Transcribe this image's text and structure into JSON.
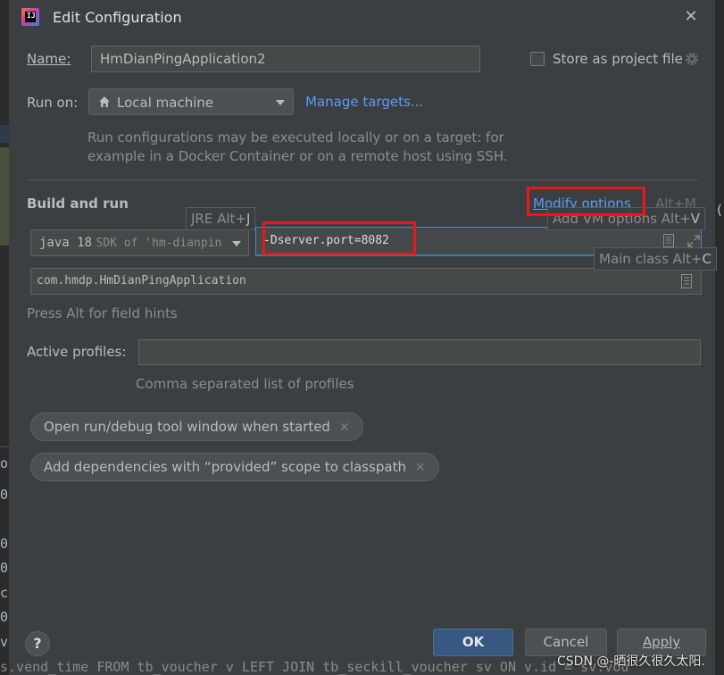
{
  "dialog": {
    "title": "Edit Configuration",
    "app_icon_text": "IJ"
  },
  "name": {
    "label": "Name:",
    "value": "HmDianPingApplication2"
  },
  "store": {
    "label": "Store as project file",
    "checked": false
  },
  "run_on": {
    "label": "Run on:",
    "value": "Local machine",
    "manage_targets": "Manage targets...",
    "hint_line1": "Run configurations may be executed locally or on a target: for",
    "hint_line2": "example in a Docker Container or on a remote host using SSH."
  },
  "build_run": {
    "heading": "Build and run",
    "modify_options": "Modify options",
    "modify_shortcut": "Alt+M",
    "jre_value": "java 18",
    "jre_sdk": "SDK of 'hm-dianpin",
    "vm_options_value": "-Dserver.port=8082",
    "main_class_value": "com.hmdp.HmDianPingApplication"
  },
  "tooltips": {
    "jre": "JRE Alt+",
    "jre_key": "J",
    "vm": "Add VM options Alt+",
    "vm_key": "V",
    "main": "Main class Alt+",
    "main_key": "C"
  },
  "field_hint": "Press Alt for field hints",
  "profiles": {
    "label": "Active profiles:",
    "value": "",
    "hint": "Comma separated list of profiles"
  },
  "chips": [
    {
      "label": "Open run/debug tool window when started"
    },
    {
      "label": "Add dependencies with “provided” scope to classpath"
    }
  ],
  "buttons": {
    "help": "?",
    "ok": "OK",
    "cancel": "Cancel",
    "apply": "Apply"
  },
  "background": {
    "left_chars": [
      "o",
      "0",
      "0",
      "0",
      "c",
      "0",
      "v"
    ],
    "bottom_line": "s.vend_time FROM tb_voucher v LEFT JOIN tb_seckill_voucher sv ON v.id = sv.vou",
    "right_edge": "("
  },
  "watermark": "CSDN @-晒很久很久太阳.",
  "colors": {
    "dialog_bg": "#3c3f41",
    "link": "#589df6",
    "highlight_box": "#e8191b",
    "ok_button": "#365880"
  }
}
